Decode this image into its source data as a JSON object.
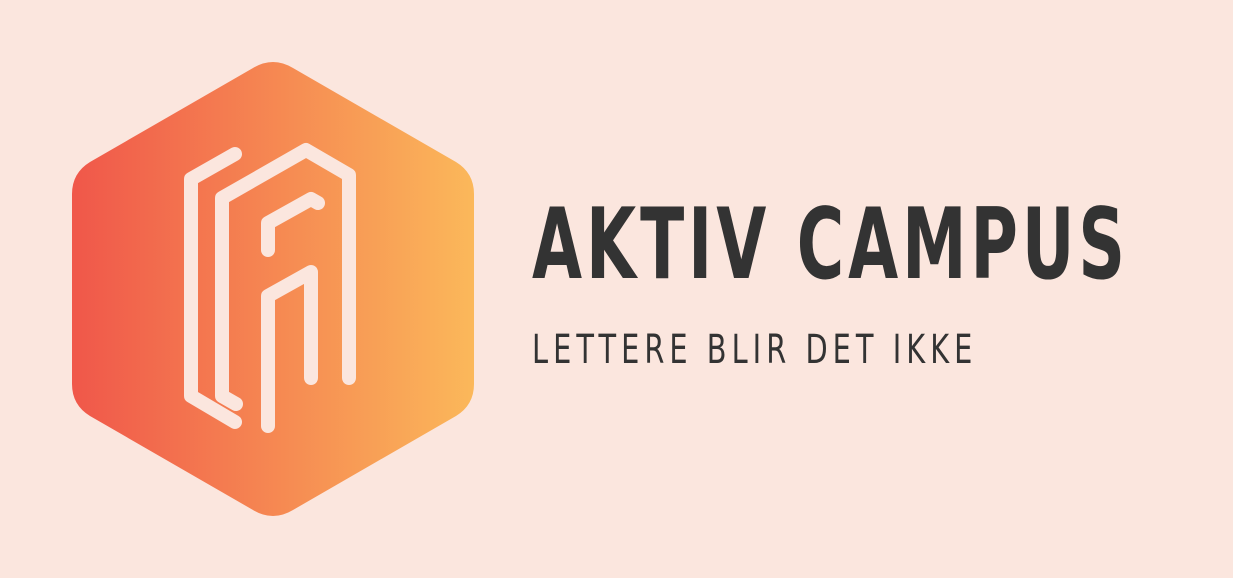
{
  "logo": {
    "brand_name": "AKTIV CAMPUS",
    "tagline": "LETTERE BLIR DET IKKE",
    "icon": "hexagon-monogram-icon",
    "colors": {
      "background": "#fbe6de",
      "gradient_start": "#f0574a",
      "gradient_end": "#fbb85a",
      "text": "#333333",
      "monogram_stroke": "#fbe6de"
    }
  }
}
